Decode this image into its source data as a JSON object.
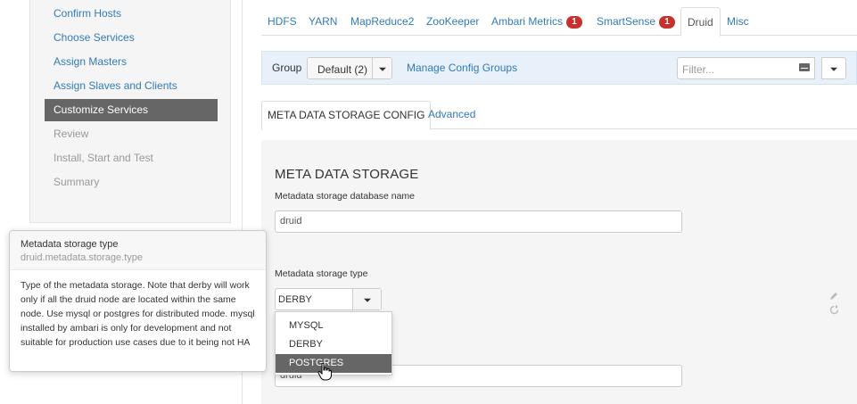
{
  "wizard": {
    "steps": [
      {
        "label": "Confirm Hosts",
        "state": "done"
      },
      {
        "label": "Choose Services",
        "state": "done"
      },
      {
        "label": "Assign Masters",
        "state": "done"
      },
      {
        "label": "Assign Slaves and Clients",
        "state": "done"
      },
      {
        "label": "Customize Services",
        "state": "active"
      },
      {
        "label": "Review",
        "state": "future"
      },
      {
        "label": "Install, Start and Test",
        "state": "future"
      },
      {
        "label": "Summary",
        "state": "future"
      }
    ]
  },
  "service_tabs": [
    {
      "label": "HDFS"
    },
    {
      "label": "YARN"
    },
    {
      "label": "MapReduce2"
    },
    {
      "label": "ZooKeeper"
    },
    {
      "label": "Ambari Metrics",
      "badge": "1"
    },
    {
      "label": "SmartSense",
      "badge": "1"
    },
    {
      "label": "Druid",
      "active": true
    },
    {
      "label": "Misc"
    }
  ],
  "group_bar": {
    "label": "Group",
    "selected": "Default (2)",
    "manage_link": "Manage Config Groups",
    "filter_placeholder": "Filter..."
  },
  "sub_tabs": {
    "active": "META DATA STORAGE CONFIG",
    "other": "Advanced"
  },
  "content": {
    "section_title": "META DATA STORAGE",
    "db_name_label": "Metadata storage database name",
    "db_name_value": "druid",
    "type_label": "Metadata storage type",
    "type_value": "DERBY",
    "type_options": [
      "MYSQL",
      "DERBY",
      "POSTGRES"
    ],
    "highlighted_option": "POSTGRES",
    "hidden_field_value": "druid"
  },
  "tooltip": {
    "title": "Metadata storage type",
    "property": "druid.metadata.storage.type",
    "body": "Type of the metadata storage. Note that derby will work only if all the druid node are located within the same node. Use mysql or postgres for distributed mode. mysql installed by ambari is only for development and not suitable for production use cases due to it being not HA"
  },
  "colors": {
    "link": "#337ab7",
    "active_bg": "#666666",
    "badge": "#c9302c",
    "group_bar_bg": "#e8f1f9"
  }
}
